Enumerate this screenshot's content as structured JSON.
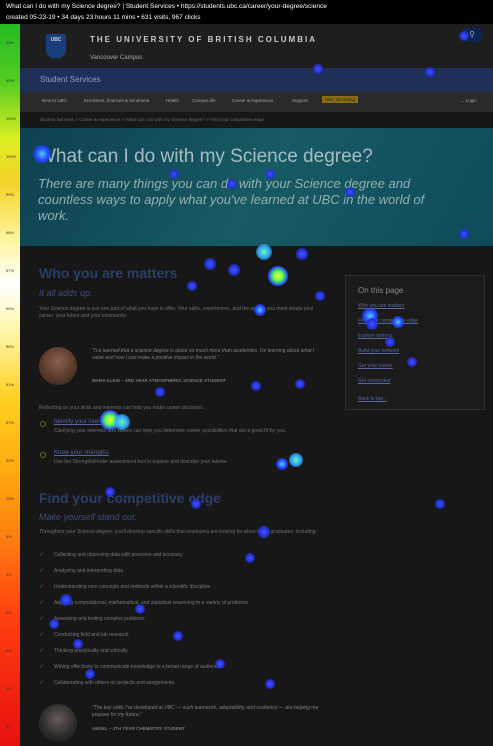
{
  "topbar": {
    "line1": "What can I do with my Science degree? | Student Services  •  https://students.ubc.ca/career/your-degree/science",
    "line2": "created 05-23-19  •  34 days 23 hours 11 mins  •  631 visits, 967 clicks"
  },
  "scale": {
    "labels": [
      "80%",
      "90%",
      "100%",
      "100%",
      "99%",
      "98%",
      "97%",
      "96%",
      "95%",
      "91%",
      "57%",
      "32%",
      "15%",
      "5%",
      "1%",
      "0%",
      "0%",
      "0%",
      "0%"
    ]
  },
  "header": {
    "logo_text": "UBC",
    "university": "THE UNIVERSITY OF BRITISH COLUMBIA",
    "campus": "Vancouver Campus",
    "search_icon": "search-icon"
  },
  "section_bar": {
    "title": "Student Services"
  },
  "nav": {
    "items": [
      "New to UBC",
      "Enrolment, finances & enrolment",
      "Health",
      "Campus life",
      "Career & experience",
      "Support",
      "UBC On Going"
    ],
    "login": "→ Login"
  },
  "breadcrumb": "Student Services > Career & experience > What can I do with my Science degree? > Find your competitive edge",
  "hero": {
    "title": "What can I do with my Science degree?",
    "subtitle": "There are many things you can do with your Science degree and countless ways to apply what you've learned at UBC in the world of work."
  },
  "who": {
    "heading": "Who you are matters",
    "subheading": "It all adds up.",
    "body": "Your Science degree is just one part of what you have to offer. Your skills, experiences, and the people you meet shape your career, your future and your community.",
    "quote": "\"I've learned that a science degree is about so much more than academics. I'm learning about what I value and how I can make a positive impact in the world.\"",
    "quote_name": "MARA KLEIN – 3RD YEAR ATMOSPHERIC SCIENCE STUDENT",
    "reflect": "Reflecting on your skills and interests can help you make career decisions.",
    "items": [
      {
        "title": "Identify your interests",
        "desc": "Clarifying your interests and values can help you determine career possibilities that are a good fit for you."
      },
      {
        "title": "Know your strengths",
        "desc": "Use the StrengthsFinder assessment tool to explore and describe your talents."
      }
    ]
  },
  "toc": {
    "title": "On this page",
    "links": [
      "Who you are matters",
      "Find your competitive edge",
      "Explore options",
      "Build your network",
      "Get your career",
      "Get connected",
      "Back to top ↑"
    ]
  },
  "edge": {
    "heading": "Find your competitive edge",
    "subheading": "Make yourself stand out.",
    "body": "Throughout your Science degree, you'll develop specific skills that employers are looking for when hiring graduates, including:",
    "skills": [
      "Collecting and observing data with precision and accuracy",
      "Analyzing and interpreting data",
      "Understanding core concepts and methods within a scientific discipline",
      "Applying computational, mathematical, and statistical reasoning to a variety of problems",
      "Assessing and testing complex problems",
      "Conducting field and lab research",
      "Thinking analytically and critically",
      "Writing effectively to communicate knowledge to a broad range of audiences",
      "Collaborating with others on projects and assignments"
    ],
    "quote": "\"The key skills I've developed at UBC — such teamwork, adaptability, and resilience — are helping me prepare for my future.\"",
    "quote_name": "ANGEL – 4TH YEAR CHEMISTRY STUDENT"
  },
  "colors": {
    "hero": "#175a64",
    "navy": "#1f2f58",
    "heat_cold": "#2233ff",
    "heat_hot": "#ffff33"
  }
}
